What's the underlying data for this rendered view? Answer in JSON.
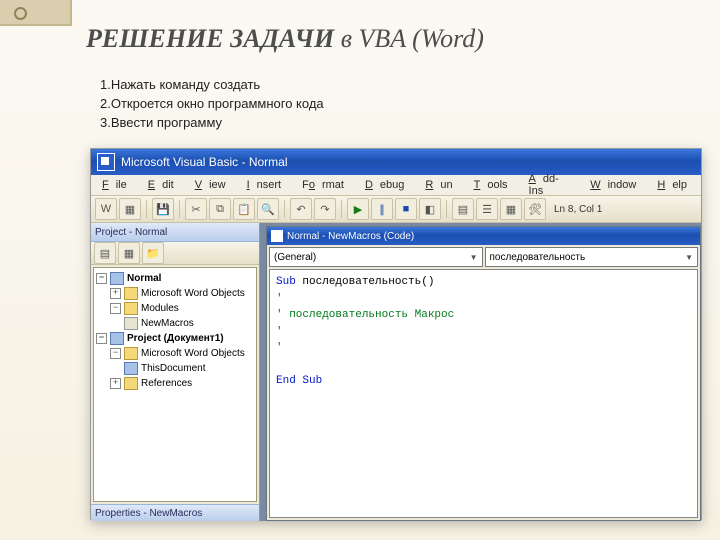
{
  "slide": {
    "title_bold": "РЕШЕНИЕ ЗАДАЧИ",
    "title_rest": "в VBA (Word)",
    "steps": [
      "1.Нажать команду создать",
      "2.Откроется окно программного кода",
      "3.Ввести программу"
    ]
  },
  "ide": {
    "title": "Microsoft Visual Basic - Normal",
    "menu": [
      "ile",
      "dit",
      "iew",
      "nsert",
      "rmat",
      "ebug",
      "un",
      "ools",
      "dd-Ins",
      "indow",
      "elp"
    ],
    "cursor": "Ln 8, Col 1",
    "project": {
      "title": "Project - Normal",
      "tree": [
        "Normal",
        "Microsoft Word Objects",
        "Modules",
        "NewMacros",
        "Project (Документ1)",
        "Microsoft Word Objects",
        "ThisDocument",
        "References"
      ]
    },
    "properties_title": "Properties - NewMacros",
    "code": {
      "title": "Normal - NewMacros (Code)",
      "object": "(General)",
      "proc": "последовательность",
      "lines": {
        "0a": "Sub",
        "0b": "последовательность()",
        "1": "'",
        "2": "' последовательность Макрос",
        "3": "'",
        "4": "'",
        "5": "End Sub"
      }
    }
  }
}
